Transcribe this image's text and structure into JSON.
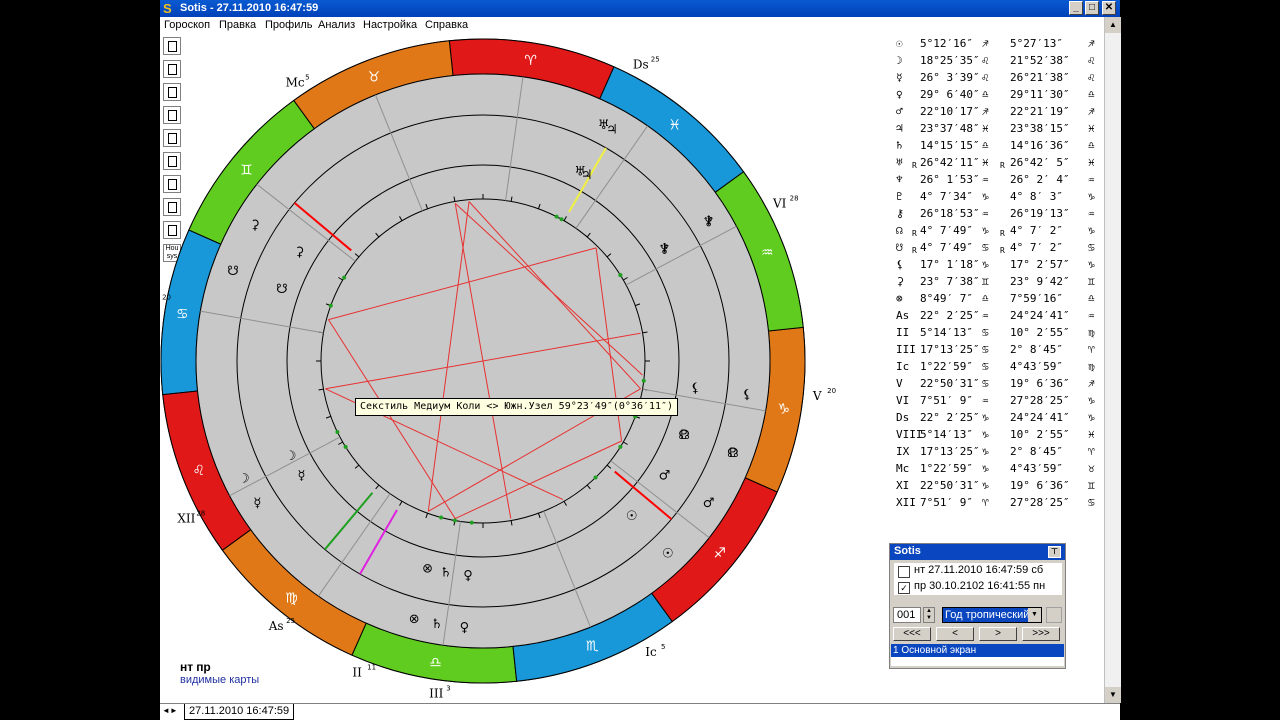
{
  "window": {
    "title": "Sotis - 27.11.2010 16:47:59",
    "minimize_label": "_",
    "maximize_label": "□",
    "close_label": "✕"
  },
  "menu": [
    "Гороскоп",
    "Правка",
    "Профиль",
    "Анализ",
    "Настройка",
    "Справка"
  ],
  "toolbar": [
    "new-document-icon",
    "edit-document-icon",
    "add-document-icon",
    "remove-document-icon",
    "copy-document-icon",
    "compare-document-icon",
    "print-icon",
    "print-preview-icon",
    "table-icon",
    "house-system-icon"
  ],
  "toolbar_house_label": "Hou sys",
  "visible_maps": {
    "label_nt": "нт",
    "label_pr": "пр",
    "caption": "видимые карты"
  },
  "document_tab": "27.11.2010 16:47:59",
  "tooltip": "Секстиль Медиум Коли <> Южн.Узел 59°23′49″(0°36′11″)",
  "wheel": {
    "sign_order": [
      "Aries",
      "Taurus",
      "Gemini",
      "Cancer",
      "Leo",
      "Virgo",
      "Libra",
      "Scorpio",
      "Sagittarius",
      "Capricorn",
      "Aquarius",
      "Pisces"
    ],
    "sign_glyphs": [
      "♈",
      "♉",
      "♊",
      "♋",
      "♌",
      "♍",
      "♎",
      "♏",
      "♐",
      "♑",
      "♒",
      "♓"
    ],
    "colors": {
      "fire": "#e01818",
      "earth": "#e07818",
      "air": "#60cc20",
      "water": "#1898d8",
      "ring": "#c8c8c8",
      "aspect": "#e83030",
      "axis": "#ff0000",
      "yellow": "#f0f040",
      "magenta": "#e020e0",
      "green": "#20a020"
    },
    "house_labels": [
      {
        "text": "IX",
        "sup": "3"
      },
      {
        "text": "VIII",
        "sup": "11"
      },
      {
        "text": "Ds",
        "sup": "25"
      },
      {
        "text": "VI",
        "sup": "28"
      },
      {
        "text": "V",
        "sup": "20"
      },
      {
        "text": "Ic",
        "sup": "5"
      },
      {
        "text": "III",
        "sup": "3"
      },
      {
        "text": "II",
        "sup": "11"
      },
      {
        "text": "As",
        "sup": "25"
      },
      {
        "text": "XII",
        "sup": "28"
      },
      {
        "text": "XI",
        "sup": "20"
      },
      {
        "text": "Mc",
        "sup": "5"
      }
    ]
  },
  "planet_table": [
    {
      "g": "☉",
      "a": "5°12′16″",
      "sa": "♐",
      "b": "5°27′13″",
      "sb": "♐",
      "r1": "",
      "r2": ""
    },
    {
      "g": "☽",
      "a": "18°25′35″",
      "sa": "♌",
      "b": "21°52′38″",
      "sb": "♌",
      "r1": "",
      "r2": ""
    },
    {
      "g": "☿",
      "a": "26° 3′39″",
      "sa": "♌",
      "b": "26°21′38″",
      "sb": "♌",
      "r1": "",
      "r2": ""
    },
    {
      "g": "♀",
      "a": "29° 6′40″",
      "sa": "♎",
      "b": "29°11′30″",
      "sb": "♎",
      "r1": "",
      "r2": ""
    },
    {
      "g": "♂",
      "a": "22°10′17″",
      "sa": "♐",
      "b": "22°21′19″",
      "sb": "♐",
      "r1": "",
      "r2": ""
    },
    {
      "g": "♃",
      "a": "23°37′48″",
      "sa": "♓",
      "b": "23°38′15″",
      "sb": "♓",
      "r1": "",
      "r2": ""
    },
    {
      "g": "♄",
      "a": "14°15′15″",
      "sa": "♎",
      "b": "14°16′36″",
      "sb": "♎",
      "r1": "",
      "r2": ""
    },
    {
      "g": "♅",
      "a": "26°42′11″",
      "sa": "♓",
      "b": "26°42′ 5″",
      "sb": "♓",
      "r1": "R",
      "r2": "R"
    },
    {
      "g": "♆",
      "a": "26° 1′53″",
      "sa": "♒",
      "b": "26° 2′ 4″",
      "sb": "♒",
      "r1": "",
      "r2": ""
    },
    {
      "g": "♇",
      "a": "4° 7′34″",
      "sa": "♑",
      "b": "4° 8′ 3″",
      "sb": "♑",
      "r1": "",
      "r2": ""
    },
    {
      "g": "⚷",
      "a": "26°18′53″",
      "sa": "♒",
      "b": "26°19′13″",
      "sb": "♒",
      "r1": "",
      "r2": ""
    },
    {
      "g": "☊",
      "a": "4° 7′49″",
      "sa": "♑",
      "b": "4° 7′ 2″",
      "sb": "♑",
      "r1": "R",
      "r2": "R"
    },
    {
      "g": "☋",
      "a": "4° 7′49″",
      "sa": "♋",
      "b": "4° 7′ 2″",
      "sb": "♋",
      "r1": "R",
      "r2": "R"
    },
    {
      "g": "⚸",
      "a": "17° 1′18″",
      "sa": "♑",
      "b": "17° 2′57″",
      "sb": "♑",
      "r1": "",
      "r2": ""
    },
    {
      "g": "⚳",
      "a": "23° 7′38″",
      "sa": "♊",
      "b": "23° 9′42″",
      "sb": "♊",
      "r1": "",
      "r2": ""
    },
    {
      "g": "⊗",
      "a": "8°49′ 7″",
      "sa": "♎",
      "b": "7°59′16″",
      "sb": "♎",
      "r1": "",
      "r2": ""
    },
    {
      "g": "As",
      "a": "22° 2′25″",
      "sa": "♒",
      "b": "24°24′41″",
      "sb": "♒",
      "r1": "",
      "r2": ""
    },
    {
      "g": "II",
      "a": "5°14′13″",
      "sa": "♋",
      "b": "10° 2′55″",
      "sb": "♍",
      "r1": "",
      "r2": ""
    },
    {
      "g": "III",
      "a": "17°13′25″",
      "sa": "♋",
      "b": "2° 8′45″",
      "sb": "♈",
      "r1": "",
      "r2": ""
    },
    {
      "g": "Ic",
      "a": "1°22′59″",
      "sa": "♋",
      "b": "4°43′59″",
      "sb": "♍",
      "r1": "",
      "r2": ""
    },
    {
      "g": "V",
      "a": "22°50′31″",
      "sa": "♋",
      "b": "19° 6′36″",
      "sb": "♐",
      "r1": "",
      "r2": ""
    },
    {
      "g": "VI",
      "a": "7°51′ 9″",
      "sa": "♒",
      "b": "27°28′25″",
      "sb": "♑",
      "r1": "",
      "r2": ""
    },
    {
      "g": "Ds",
      "a": "22° 2′25″",
      "sa": "♑",
      "b": "24°24′41″",
      "sb": "♑",
      "r1": "",
      "r2": ""
    },
    {
      "g": "VIII",
      "a": "5°14′13″",
      "sa": "♑",
      "b": "10° 2′55″",
      "sb": "♓",
      "r1": "",
      "r2": ""
    },
    {
      "g": "IX",
      "a": "17°13′25″",
      "sa": "♑",
      "b": "2° 8′45″",
      "sb": "♈",
      "r1": "",
      "r2": ""
    },
    {
      "g": "Mc",
      "a": "1°22′59″",
      "sa": "♑",
      "b": "4°43′59″",
      "sb": "♉",
      "r1": "",
      "r2": ""
    },
    {
      "g": "XI",
      "a": "22°50′31″",
      "sa": "♑",
      "b": "19° 6′36″",
      "sb": "♊",
      "r1": "",
      "r2": ""
    },
    {
      "g": "XII",
      "a": "7°51′ 9″",
      "sa": "♈",
      "b": "27°28′25″",
      "sb": "♋",
      "r1": "",
      "r2": ""
    }
  ],
  "sotis": {
    "title": "Sotis",
    "date1": "нт 27.11.2010 16:47:59 сб",
    "date1_checked": false,
    "date2": "пр 30.10.2102 16:41:55 пн",
    "date2_checked": true,
    "step_value": "001",
    "step_unit": "Год тропический",
    "btn_back3": "<<<",
    "btn_back": "<",
    "btn_fwd": ">",
    "btn_fwd3": ">>>",
    "screen_item": "1 Основной экран"
  }
}
